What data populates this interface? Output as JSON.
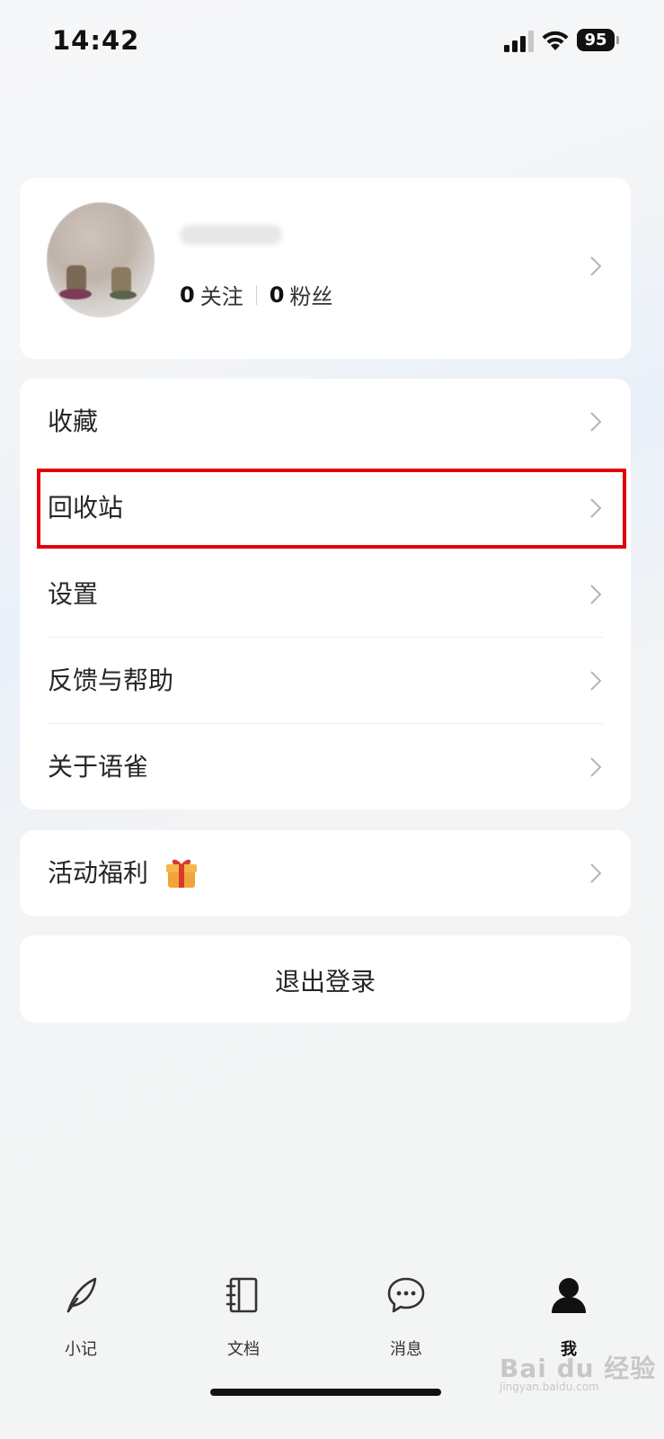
{
  "status_bar": {
    "time": "14:42",
    "battery": "95"
  },
  "profile": {
    "following_count": "0",
    "following_label": "关注",
    "followers_count": "0",
    "followers_label": "粉丝"
  },
  "menu": {
    "items": [
      {
        "label": "收藏"
      },
      {
        "label": "回收站"
      },
      {
        "label": "设置"
      },
      {
        "label": "反馈与帮助"
      },
      {
        "label": "关于语雀"
      }
    ]
  },
  "activity": {
    "label": "活动福利"
  },
  "logout": {
    "label": "退出登录"
  },
  "tabs": [
    {
      "label": "小记",
      "icon": "feather-icon"
    },
    {
      "label": "文档",
      "icon": "notebook-icon"
    },
    {
      "label": "消息",
      "icon": "chat-bubble-icon"
    },
    {
      "label": "我",
      "icon": "person-icon"
    }
  ],
  "watermark": {
    "text": "Bai du 经验",
    "sub": "jingyan.baidu.com"
  },
  "colors": {
    "highlight": "#e3000b"
  }
}
